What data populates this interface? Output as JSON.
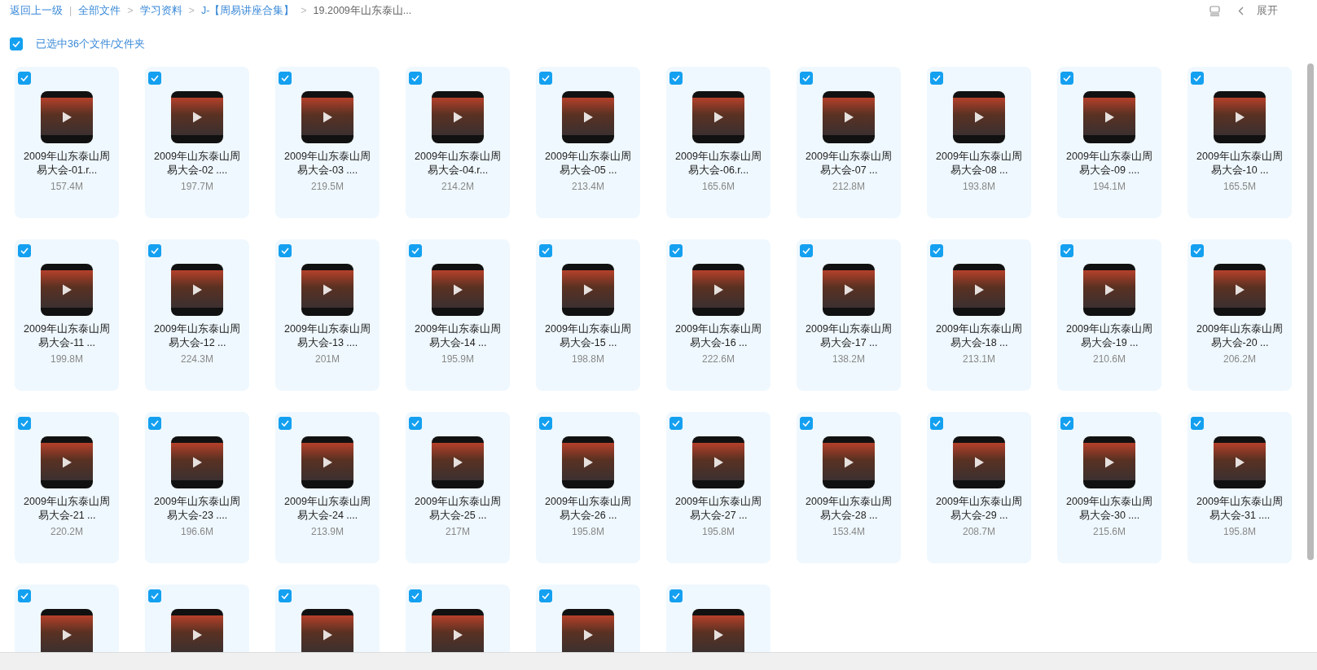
{
  "breadcrumb": {
    "back": "返回上一级",
    "divider": "|",
    "items": [
      {
        "label": "全部文件",
        "kind": "link"
      },
      {
        "label": "学习资料",
        "sep": ">",
        "kind": "link"
      },
      {
        "label": "J-【周易讲座合集】",
        "sep": ">",
        "kind": "link"
      },
      {
        "label": "19.2009年山东泰山...",
        "sep": ">",
        "kind": "current"
      }
    ]
  },
  "toolbar": {
    "expand": "展开"
  },
  "selection": {
    "label": "已选中36个文件/文件夹",
    "checked": true
  },
  "files": [
    {
      "name": "2009年山东泰山周易大会-01.r...",
      "size": "157.4M",
      "selected": true
    },
    {
      "name": "2009年山东泰山周易大会-02 ....",
      "size": "197.7M",
      "selected": true
    },
    {
      "name": "2009年山东泰山周易大会-03 ....",
      "size": "219.5M",
      "selected": true
    },
    {
      "name": "2009年山东泰山周易大会-04.r...",
      "size": "214.2M",
      "selected": true
    },
    {
      "name": "2009年山东泰山周易大会-05 ...",
      "size": "213.4M",
      "selected": true
    },
    {
      "name": "2009年山东泰山周易大会-06.r...",
      "size": "165.6M",
      "selected": true
    },
    {
      "name": "2009年山东泰山周易大会-07 ...",
      "size": "212.8M",
      "selected": true
    },
    {
      "name": "2009年山东泰山周易大会-08 ...",
      "size": "193.8M",
      "selected": true
    },
    {
      "name": "2009年山东泰山周易大会-09 ....",
      "size": "194.1M",
      "selected": true
    },
    {
      "name": "2009年山东泰山周易大会-10 ...",
      "size": "165.5M",
      "selected": true
    },
    {
      "name": "2009年山东泰山周易大会-11 ...",
      "size": "199.8M",
      "selected": true
    },
    {
      "name": "2009年山东泰山周易大会-12 ...",
      "size": "224.3M",
      "selected": true
    },
    {
      "name": "2009年山东泰山周易大会-13 ....",
      "size": "201M",
      "selected": true
    },
    {
      "name": "2009年山东泰山周易大会-14 ...",
      "size": "195.9M",
      "selected": true
    },
    {
      "name": "2009年山东泰山周易大会-15 ...",
      "size": "198.8M",
      "selected": true
    },
    {
      "name": "2009年山东泰山周易大会-16 ...",
      "size": "222.6M",
      "selected": true
    },
    {
      "name": "2009年山东泰山周易大会-17 ...",
      "size": "138.2M",
      "selected": true
    },
    {
      "name": "2009年山东泰山周易大会-18 ...",
      "size": "213.1M",
      "selected": true
    },
    {
      "name": "2009年山东泰山周易大会-19 ...",
      "size": "210.6M",
      "selected": true
    },
    {
      "name": "2009年山东泰山周易大会-20 ...",
      "size": "206.2M",
      "selected": true
    },
    {
      "name": "2009年山东泰山周易大会-21 ...",
      "size": "220.2M",
      "selected": true
    },
    {
      "name": "2009年山东泰山周易大会-23 ....",
      "size": "196.6M",
      "selected": true
    },
    {
      "name": "2009年山东泰山周易大会-24 ....",
      "size": "213.9M",
      "selected": true
    },
    {
      "name": "2009年山东泰山周易大会-25 ...",
      "size": "217M",
      "selected": true
    },
    {
      "name": "2009年山东泰山周易大会-26 ...",
      "size": "195.8M",
      "selected": true
    },
    {
      "name": "2009年山东泰山周易大会-27 ...",
      "size": "195.8M",
      "selected": true
    },
    {
      "name": "2009年山东泰山周易大会-28 ...",
      "size": "153.4M",
      "selected": true
    },
    {
      "name": "2009年山东泰山周易大会-29 ...",
      "size": "208.7M",
      "selected": true
    },
    {
      "name": "2009年山东泰山周易大会-30 ....",
      "size": "215.6M",
      "selected": true
    },
    {
      "name": "2009年山东泰山周易大会-31 ....",
      "size": "195.8M",
      "selected": true
    },
    {
      "selected": true
    },
    {
      "selected": true
    },
    {
      "selected": true
    },
    {
      "selected": true
    },
    {
      "selected": true
    },
    {
      "selected": true
    }
  ]
}
